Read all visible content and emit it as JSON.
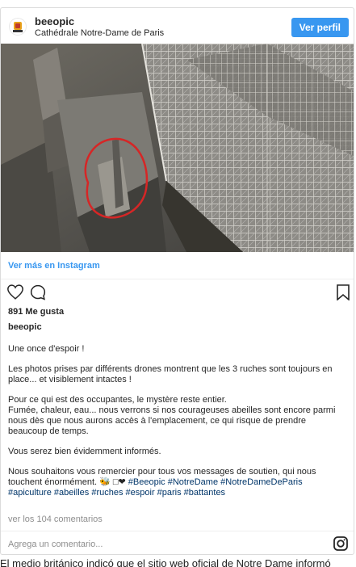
{
  "post": {
    "username": "beeopic",
    "location": "Cathédrale Notre-Dame de Paris",
    "follow_label": "Ver perfil",
    "view_more_label": "Ver más en Instagram",
    "likes": "891 Me gusta",
    "caption_user": "beeopic",
    "caption": {
      "p1": "Une once d'espoir !",
      "p2": "Les photos prises par différents drones montrent que les 3 ruches sont toujours en place... et visiblement intactes !",
      "p3": "Pour ce qui est des occupantes, le mystère reste entier.\nFumée, chaleur, eau... nous verrons si nos courageuses abeilles sont encore parmi nous dès que nous aurons accès à l'emplacement, ce qui risque de prendre beaucoup de temps.",
      "p4": "Vous serez bien évidemment informés.",
      "p5_text": "Nous souhaitons vous remercier pour tous vos messages de soutien, qui nous touchent énormément. 🐝 □❤ ",
      "p5_tags": "#Beeopic #NotreDame #NotreDameDeParis #apiculture #abeilles #ruches #espoir #paris #battantes"
    },
    "view_comments": "ver los 104 comentarios",
    "add_comment_placeholder": "Agrega un comentario...",
    "icons": {
      "like": "heart-icon",
      "comment": "comment-icon",
      "save": "bookmark-icon",
      "instagram": "instagram-icon",
      "avatar": "beeopic-logo"
    }
  },
  "article_text": "El medio británico indicó que el sitio web oficial de Notre Dame informó"
}
